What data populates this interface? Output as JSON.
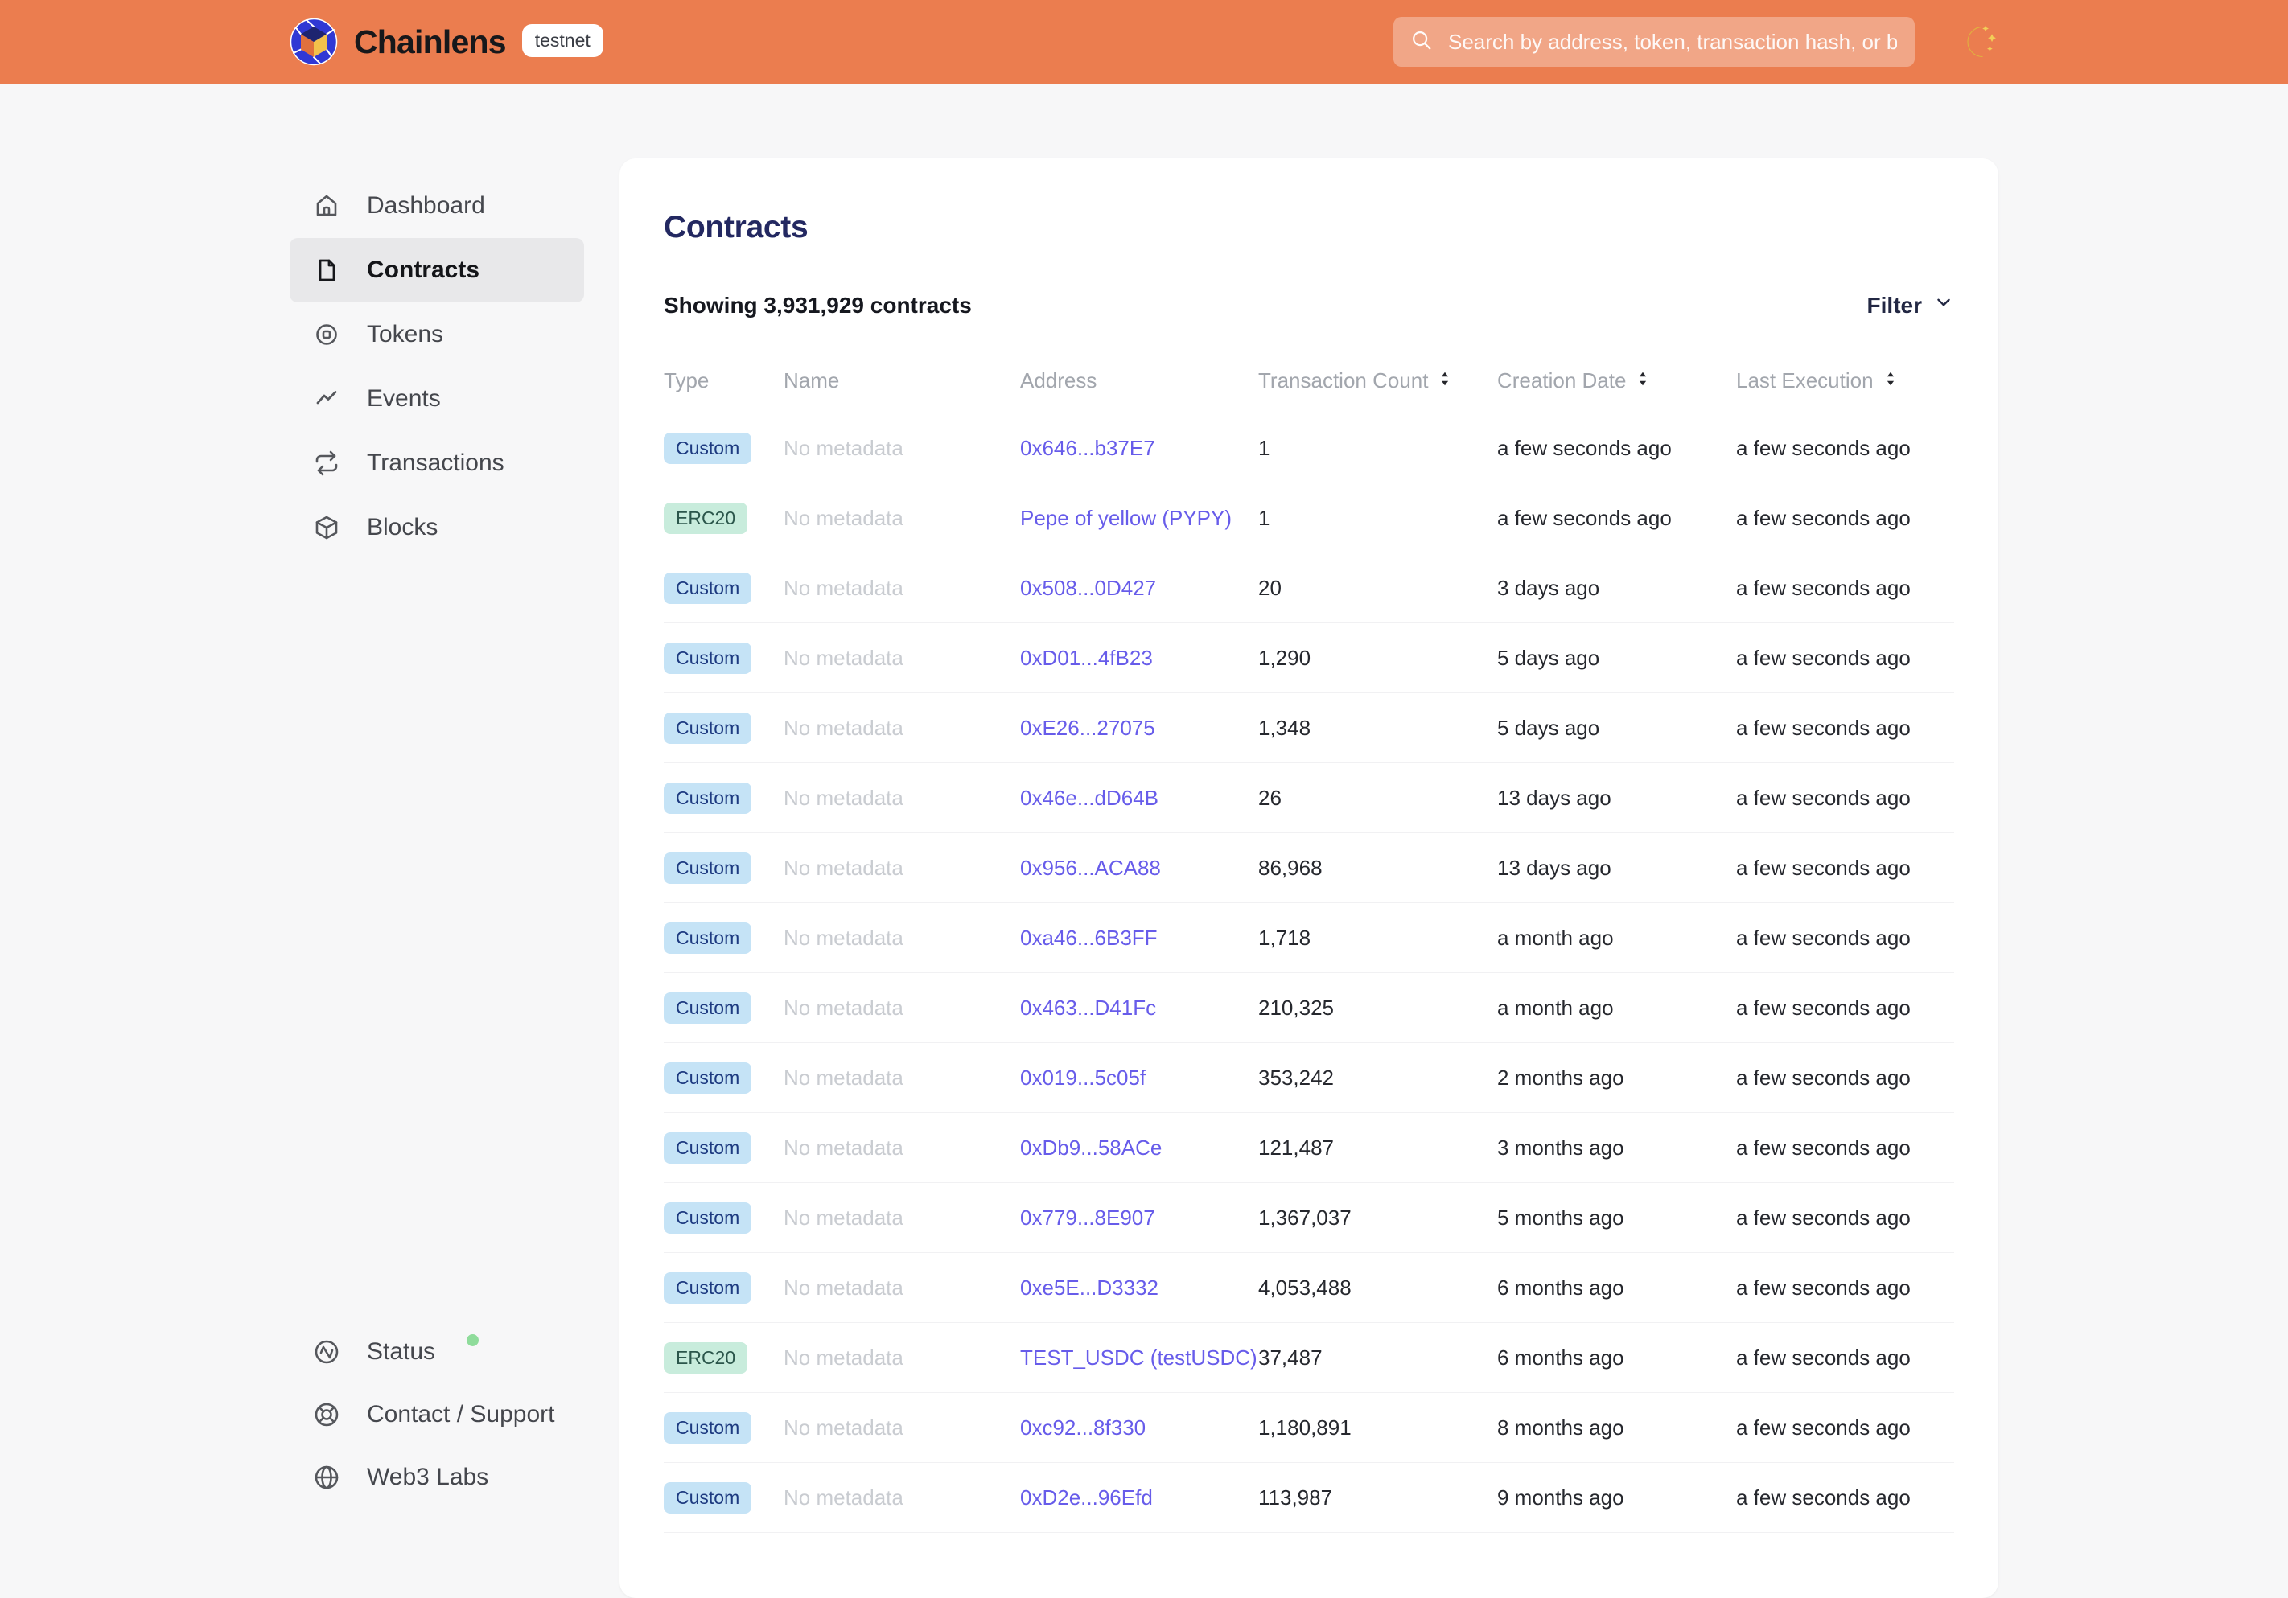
{
  "colors": {
    "header_bg": "#EB7D4F",
    "page_bg": "#F7F7F8",
    "card_bg": "#FFFFFF",
    "title_text": "#232861",
    "link": "#675CEA",
    "badge_custom_bg": "#C5E3F6",
    "badge_custom_text": "#1D3A80",
    "badge_erc20_bg": "#C8ECDC",
    "badge_erc20_text": "#2B564B",
    "status_dot": "#8FDC9B",
    "active_item_bg": "#E8E8EA"
  },
  "header": {
    "brand": "Chainlens",
    "network_badge": "testnet",
    "search_placeholder": "Search by address, token, transaction hash, or block number",
    "theme_toggle_icon": "moon-icon"
  },
  "sidebar": {
    "items": [
      {
        "label": "Dashboard",
        "icon": "home-icon",
        "active": false
      },
      {
        "label": "Contracts",
        "icon": "file-icon",
        "active": true
      },
      {
        "label": "Tokens",
        "icon": "token-icon",
        "active": false
      },
      {
        "label": "Events",
        "icon": "activity-line-icon",
        "active": false
      },
      {
        "label": "Transactions",
        "icon": "repeat-icon",
        "active": false
      },
      {
        "label": "Blocks",
        "icon": "cube-icon",
        "active": false
      }
    ],
    "footer_items": [
      {
        "label": "Status",
        "icon": "pulse-circle-icon",
        "status_dot": true
      },
      {
        "label": "Contact / Support",
        "icon": "lifebuoy-icon",
        "status_dot": false
      },
      {
        "label": "Web3 Labs",
        "icon": "globe-icon",
        "status_dot": false
      }
    ]
  },
  "main": {
    "title": "Contracts",
    "summary": "Showing 3,931,929 contracts",
    "filter_label": "Filter",
    "table": {
      "columns": [
        {
          "label": "Type",
          "sortable": false
        },
        {
          "label": "Name",
          "sortable": false
        },
        {
          "label": "Address",
          "sortable": false
        },
        {
          "label": "Transaction Count",
          "sortable": true
        },
        {
          "label": "Creation Date",
          "sortable": true
        },
        {
          "label": "Last Execution",
          "sortable": true
        }
      ],
      "rows": [
        {
          "type": "Custom",
          "name": "No metadata",
          "address": "0x646...b37E7",
          "tx_count": "1",
          "creation_date": "a few seconds ago",
          "last_execution": "a few seconds ago"
        },
        {
          "type": "ERC20",
          "name": "No metadata",
          "address": "Pepe of yellow (PYPY)",
          "tx_count": "1",
          "creation_date": "a few seconds ago",
          "last_execution": "a few seconds ago"
        },
        {
          "type": "Custom",
          "name": "No metadata",
          "address": "0x508...0D427",
          "tx_count": "20",
          "creation_date": "3 days ago",
          "last_execution": "a few seconds ago"
        },
        {
          "type": "Custom",
          "name": "No metadata",
          "address": "0xD01...4fB23",
          "tx_count": "1,290",
          "creation_date": "5 days ago",
          "last_execution": "a few seconds ago"
        },
        {
          "type": "Custom",
          "name": "No metadata",
          "address": "0xE26...27075",
          "tx_count": "1,348",
          "creation_date": "5 days ago",
          "last_execution": "a few seconds ago"
        },
        {
          "type": "Custom",
          "name": "No metadata",
          "address": "0x46e...dD64B",
          "tx_count": "26",
          "creation_date": "13 days ago",
          "last_execution": "a few seconds ago"
        },
        {
          "type": "Custom",
          "name": "No metadata",
          "address": "0x956...ACA88",
          "tx_count": "86,968",
          "creation_date": "13 days ago",
          "last_execution": "a few seconds ago"
        },
        {
          "type": "Custom",
          "name": "No metadata",
          "address": "0xa46...6B3FF",
          "tx_count": "1,718",
          "creation_date": "a month ago",
          "last_execution": "a few seconds ago"
        },
        {
          "type": "Custom",
          "name": "No metadata",
          "address": "0x463...D41Fc",
          "tx_count": "210,325",
          "creation_date": "a month ago",
          "last_execution": "a few seconds ago"
        },
        {
          "type": "Custom",
          "name": "No metadata",
          "address": "0x019...5c05f",
          "tx_count": "353,242",
          "creation_date": "2 months ago",
          "last_execution": "a few seconds ago"
        },
        {
          "type": "Custom",
          "name": "No metadata",
          "address": "0xDb9...58ACe",
          "tx_count": "121,487",
          "creation_date": "3 months ago",
          "last_execution": "a few seconds ago"
        },
        {
          "type": "Custom",
          "name": "No metadata",
          "address": "0x779...8E907",
          "tx_count": "1,367,037",
          "creation_date": "5 months ago",
          "last_execution": "a few seconds ago"
        },
        {
          "type": "Custom",
          "name": "No metadata",
          "address": "0xe5E...D3332",
          "tx_count": "4,053,488",
          "creation_date": "6 months ago",
          "last_execution": "a few seconds ago"
        },
        {
          "type": "ERC20",
          "name": "No metadata",
          "address": "TEST_USDC (testUSDC)",
          "tx_count": "37,487",
          "creation_date": "6 months ago",
          "last_execution": "a few seconds ago"
        },
        {
          "type": "Custom",
          "name": "No metadata",
          "address": "0xc92...8f330",
          "tx_count": "1,180,891",
          "creation_date": "8 months ago",
          "last_execution": "a few seconds ago"
        },
        {
          "type": "Custom",
          "name": "No metadata",
          "address": "0xD2e...96Efd",
          "tx_count": "113,987",
          "creation_date": "9 months ago",
          "last_execution": "a few seconds ago"
        }
      ]
    }
  }
}
